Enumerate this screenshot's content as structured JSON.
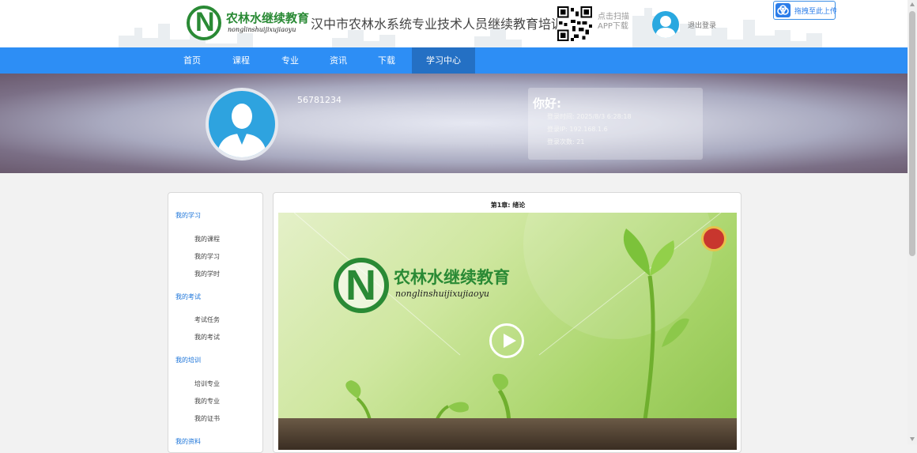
{
  "header": {
    "logo_cn": "农林水继续教育",
    "logo_pinyin": "nonglinshuijixujiaoyu",
    "site_title": "汉中市农林水系统专业技术人员继续教育培训网",
    "scan_line1": "点击扫描",
    "scan_line2": "APP下载",
    "logout": "退出登录",
    "upload": "拖拽至此上传"
  },
  "nav": {
    "items": [
      "首页",
      "课程",
      "专业",
      "资讯",
      "下载",
      "学习中心"
    ],
    "active": "学习中心"
  },
  "profile": {
    "username": "56781234",
    "greeting": "你好:",
    "login_time": "登录时间: 2025/8/3 6:28:18",
    "login_ip": "登录IP: 192.168.1.6",
    "login_count": "登录次数: 21"
  },
  "sidebar": {
    "sections": [
      {
        "title": "我的学习",
        "items": [
          "我的课程",
          "我的学习",
          "我的学时"
        ]
      },
      {
        "title": "我的考试",
        "items": [
          "考试任务",
          "我的考试"
        ]
      },
      {
        "title": "我的培训",
        "items": [
          "培训专业",
          "我的专业",
          "我的证书"
        ]
      },
      {
        "title": "我的资料",
        "items": []
      }
    ]
  },
  "content": {
    "chapter_title": "第1章: 绪论",
    "video_logo_cn": "农林水继续教育",
    "video_logo_pinyin": "nonglinshuijixujiaoyu"
  },
  "icons": {
    "play": "play-icon",
    "upload": "cloud-icon",
    "avatar": "user-icon",
    "qr": "qr-code-icon"
  },
  "colors": {
    "nav": "#2d8ef5",
    "nav_active": "#2470c4",
    "brand_green": "#2a8a35",
    "link_blue": "#1a73d9"
  }
}
